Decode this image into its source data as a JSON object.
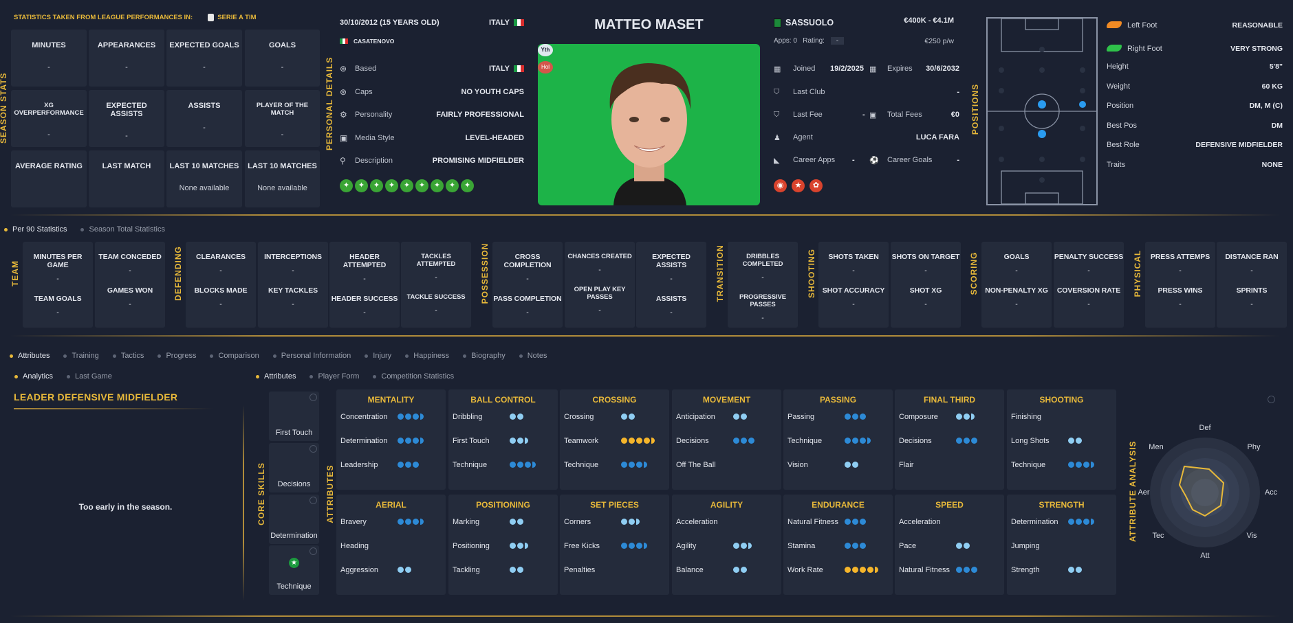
{
  "season": {
    "taken_from": "STATISTICS TAKEN FROM LEAGUE PERFORMANCES IN:",
    "league": "SERIE A TIM",
    "vlabel": "SEASON STATS",
    "stats": [
      {
        "label": "MINUTES",
        "value": "-"
      },
      {
        "label": "APPEARANCES",
        "value": "-"
      },
      {
        "label": "EXPECTED GOALS",
        "value": "-"
      },
      {
        "label": "GOALS",
        "value": "-"
      },
      {
        "label": "XG OVERPERFORMANCE",
        "value": "-"
      },
      {
        "label": "EXPECTED ASSISTS",
        "value": "-"
      },
      {
        "label": "ASSISTS",
        "value": "-"
      },
      {
        "label": "PLAYER OF THE MATCH",
        "value": "-"
      },
      {
        "label": "AVERAGE RATING",
        "value": ""
      },
      {
        "label": "LAST MATCH",
        "value": ""
      },
      {
        "label": "LAST 10 MATCHES",
        "value": "None available"
      },
      {
        "label": "LAST 10 MATCHES",
        "value": "None available"
      }
    ]
  },
  "personal": {
    "vlabel": "PERSONAL DETAILS",
    "dob": "30/10/2012 (15 YEARS OLD)",
    "nation": "ITALY",
    "birthplace": "CASATENOVO",
    "rows": [
      {
        "label": "Based",
        "value": "ITALY",
        "icon": "globe-icon"
      },
      {
        "label": "Caps",
        "value": "NO YOUTH CAPS",
        "icon": "globe-icon"
      },
      {
        "label": "Personality",
        "value": "FAIRLY PROFESSIONAL",
        "icon": "cogs-icon"
      },
      {
        "label": "Media Style",
        "value": "LEVEL-HEADED",
        "icon": "camera-icon"
      },
      {
        "label": "Description",
        "value": "PROMISING MIDFIELDER",
        "icon": "runner-icon"
      }
    ]
  },
  "player": {
    "name": "MATTEO MASET",
    "badge_yth": "Yth",
    "badge_hol": "Hol"
  },
  "contract": {
    "club": "SASSUOLO",
    "wage_range": "€400K - €4.1M",
    "apps_label": "Apps:",
    "apps": "0",
    "rating_label": "Rating:",
    "rating": "-",
    "wage": "€250 p/w",
    "joined_label": "Joined",
    "joined": "19/2/2025",
    "expires_label": "Expires",
    "expires": "30/6/2032",
    "last_club_label": "Last Club",
    "last_club": "-",
    "last_fee_label": "Last Fee",
    "last_fee": "-",
    "total_fees_label": "Total Fees",
    "total_fees": "€0",
    "agent_label": "Agent",
    "agent": "LUCA FARA",
    "career_apps_label": "Career Apps",
    "career_apps": "-",
    "career_goals_label": "Career Goals",
    "career_goals": "-"
  },
  "positions": {
    "vlabel": "POSITIONS",
    "rows": [
      {
        "label": "Left Foot",
        "value": "REASONABLE"
      },
      {
        "label": "Right Foot",
        "value": "VERY STRONG"
      },
      {
        "label": "Height",
        "value": "5'8\""
      },
      {
        "label": "Weight",
        "value": "60 KG"
      },
      {
        "label": "Position",
        "value": "DM, M (C)"
      },
      {
        "label": "Best Pos",
        "value": "DM"
      },
      {
        "label": "Best Role",
        "value": "DEFENSIVE MIDFIELDER"
      },
      {
        "label": "Traits",
        "value": "NONE"
      }
    ]
  },
  "stat_tabs": [
    "Per 90 Statistics",
    "Season Total Statistics"
  ],
  "p90": {
    "groups": [
      "TEAM",
      "DEFENDING",
      "POSSESSION",
      "TRANSITION",
      "SHOOTING",
      "SCORING",
      "PHYSICAL"
    ],
    "cells": [
      {
        "a": "MINUTES PER GAME",
        "c": "TEAM GOALS"
      },
      {
        "a": "TEAM CONCEDED",
        "c": "GAMES WON"
      },
      {
        "a": "CLEARANCES",
        "c": "BLOCKS MADE"
      },
      {
        "a": "INTERCEPTIONS",
        "c": "KEY TACKLES"
      },
      {
        "a": "HEADER ATTEMPTED",
        "c": "HEADER SUCCESS"
      },
      {
        "a": "TACKLES ATTEMPTED",
        "c": "TACKLE SUCCESS"
      },
      {
        "a": "CROSS COMPLETION",
        "c": "PASS COMPLETION"
      },
      {
        "a": "CHANCES CREATED",
        "c": "OPEN PLAY KEY PASSES"
      },
      {
        "a": "EXPECTED ASSISTS",
        "c": "ASSISTS"
      },
      {
        "a": "DRIBBLES COMPLETED",
        "c": "PROGRESSIVE PASSES"
      },
      {
        "a": "SHOTS TAKEN",
        "c": "SHOT ACCURACY"
      },
      {
        "a": "SHOTS ON TARGET",
        "c": "SHOT XG"
      },
      {
        "a": "GOALS",
        "c": "NON-PENALTY XG"
      },
      {
        "a": "PENALTY SUCCESS",
        "c": "COVERSION RATE"
      },
      {
        "a": "PRESS ATTEMPS",
        "c": "PRESS WINS"
      },
      {
        "a": "DISTANCE RAN",
        "c": "SPRINTS"
      }
    ],
    "dash": "-"
  },
  "main_tabs": [
    "Attributes",
    "Training",
    "Tactics",
    "Progress",
    "Comparison",
    "Personal Information",
    "Injury",
    "Happiness",
    "Biography",
    "Notes"
  ],
  "left_tabs": [
    "Analytics",
    "Last Game"
  ],
  "sub_tabs": [
    "Attributes",
    "Player Form",
    "Competition Statistics"
  ],
  "analytics": {
    "title": "LEADER DEFENSIVE MIDFIELDER",
    "message": "Too early in the season."
  },
  "core": {
    "vlabel": "CORE SKILLS",
    "items": [
      "First Touch",
      "Decisions",
      "Determination",
      "Technique"
    ]
  },
  "attributes_vlabel": "ATTRIBUTES",
  "analysis_vlabel": "ATTRIBUTE ANALYSIS",
  "panels": [
    {
      "title": "MENTALITY",
      "rows": [
        {
          "n": "Concentration",
          "v": 3.5,
          "c": "d"
        },
        {
          "n": "Determination",
          "v": 3.5,
          "c": "d"
        },
        {
          "n": "Leadership",
          "v": 3,
          "c": "d"
        }
      ]
    },
    {
      "title": "BALL CONTROL",
      "rows": [
        {
          "n": "Dribbling",
          "v": 2,
          "c": "l"
        },
        {
          "n": "First Touch",
          "v": 2.5,
          "c": "l"
        },
        {
          "n": "Technique",
          "v": 3.5,
          "c": "d"
        }
      ]
    },
    {
      "title": "CROSSING",
      "rows": [
        {
          "n": "Crossing",
          "v": 2,
          "c": "l"
        },
        {
          "n": "Teamwork",
          "v": 4.5,
          "c": "y"
        },
        {
          "n": "Technique",
          "v": 3.5,
          "c": "d"
        }
      ]
    },
    {
      "title": "MOVEMENT",
      "rows": [
        {
          "n": "Anticipation",
          "v": 2,
          "c": "l"
        },
        {
          "n": "Decisions",
          "v": 3,
          "c": "d"
        },
        {
          "n": "Off The Ball",
          "v": 0,
          "c": "l"
        }
      ]
    },
    {
      "title": "PASSING",
      "rows": [
        {
          "n": "Passing",
          "v": 3,
          "c": "d"
        },
        {
          "n": "Technique",
          "v": 3.5,
          "c": "d"
        },
        {
          "n": "Vision",
          "v": 2,
          "c": "l"
        }
      ]
    },
    {
      "title": "FINAL THIRD",
      "rows": [
        {
          "n": "Composure",
          "v": 2.5,
          "c": "l"
        },
        {
          "n": "Decisions",
          "v": 3,
          "c": "d"
        },
        {
          "n": "Flair",
          "v": 0,
          "c": "l"
        }
      ]
    },
    {
      "title": "SHOOTING",
      "rows": [
        {
          "n": "Finishing",
          "v": 0,
          "c": "l"
        },
        {
          "n": "Long Shots",
          "v": 2,
          "c": "l"
        },
        {
          "n": "Technique",
          "v": 3.5,
          "c": "d"
        }
      ]
    },
    {
      "title": "AERIAL",
      "rows": [
        {
          "n": "Bravery",
          "v": 3.5,
          "c": "d"
        },
        {
          "n": "Heading",
          "v": 0,
          "c": "l"
        },
        {
          "n": "Aggression",
          "v": 2,
          "c": "l"
        }
      ]
    },
    {
      "title": "POSITIONING",
      "rows": [
        {
          "n": "Marking",
          "v": 2,
          "c": "l"
        },
        {
          "n": "Positioning",
          "v": 2.5,
          "c": "l"
        },
        {
          "n": "Tackling",
          "v": 2,
          "c": "l"
        }
      ]
    },
    {
      "title": "SET PIECES",
      "rows": [
        {
          "n": "Corners",
          "v": 2.5,
          "c": "l"
        },
        {
          "n": "Free Kicks",
          "v": 3.5,
          "c": "d"
        },
        {
          "n": "Penalties",
          "v": 0,
          "c": "l"
        }
      ]
    },
    {
      "title": "AGILITY",
      "rows": [
        {
          "n": "Acceleration",
          "v": 0,
          "c": "l"
        },
        {
          "n": "Agility",
          "v": 2.5,
          "c": "l"
        },
        {
          "n": "Balance",
          "v": 2,
          "c": "l"
        }
      ]
    },
    {
      "title": "ENDURANCE",
      "rows": [
        {
          "n": "Natural Fitness",
          "v": 3,
          "c": "d"
        },
        {
          "n": "Stamina",
          "v": 3,
          "c": "d"
        },
        {
          "n": "Work Rate",
          "v": 4.5,
          "c": "y"
        }
      ]
    },
    {
      "title": "SPEED",
      "rows": [
        {
          "n": "Acceleration",
          "v": 0,
          "c": "l"
        },
        {
          "n": "Pace",
          "v": 2,
          "c": "l"
        },
        {
          "n": "Natural Fitness",
          "v": 3,
          "c": "d"
        }
      ]
    },
    {
      "title": "STRENGTH",
      "rows": [
        {
          "n": "Determination",
          "v": 3.5,
          "c": "d"
        },
        {
          "n": "Jumping",
          "v": 0,
          "c": "l"
        },
        {
          "n": "Strength",
          "v": 2,
          "c": "l"
        }
      ]
    }
  ],
  "radar": {
    "axes": [
      "Def",
      "Phy",
      "Acc",
      "Vis",
      "Att",
      "Tec",
      "Aer",
      "Men"
    ]
  },
  "colors": {
    "accent": "#e8b93a",
    "background": "#1b2131",
    "card": "#242b3b",
    "dot_light": "#8fcdf2",
    "dot_dark": "#2d8ad6",
    "dot_gold": "#f5b52b"
  }
}
